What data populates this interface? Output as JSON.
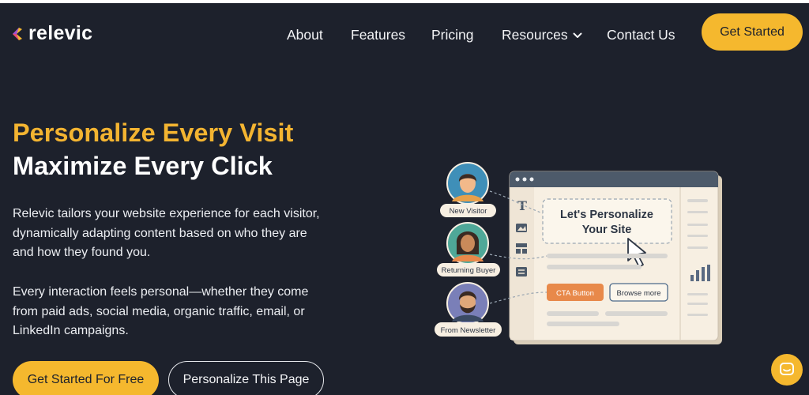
{
  "brand": {
    "name": "relevic",
    "accent": "#f5b82e",
    "background": "#1d212c"
  },
  "nav": {
    "items": [
      {
        "label": "About"
      },
      {
        "label": "Features"
      },
      {
        "label": "Pricing"
      },
      {
        "label": "Resources",
        "icon": "chevron-down-icon"
      },
      {
        "label": "Contact Us"
      }
    ],
    "cta_label": "Get Started"
  },
  "hero": {
    "headline_1": "Personalize Every Visit",
    "headline_2": "Maximize Every Click",
    "paragraph_1": "Relevic tailors your website experience for each visitor, dynamically adapting content based on who they are and how they found you.",
    "paragraph_2": "Every interaction feels personal—whether they come from paid ads, social media, organic traffic, email, or LinkedIn campaigns.",
    "primary_button": "Get Started For Free",
    "secondary_button": "Personalize This Page"
  },
  "illustration": {
    "visitors": [
      {
        "label": "New Visitor"
      },
      {
        "label": "Returning Buyer"
      },
      {
        "label": "From Newsletter"
      }
    ],
    "card_heading_1": "Let's Personalize",
    "card_heading_2": "Your Site",
    "cta_button": "CTA Button",
    "browse_button": "Browse more"
  },
  "chat": {
    "icon": "chat-icon"
  }
}
